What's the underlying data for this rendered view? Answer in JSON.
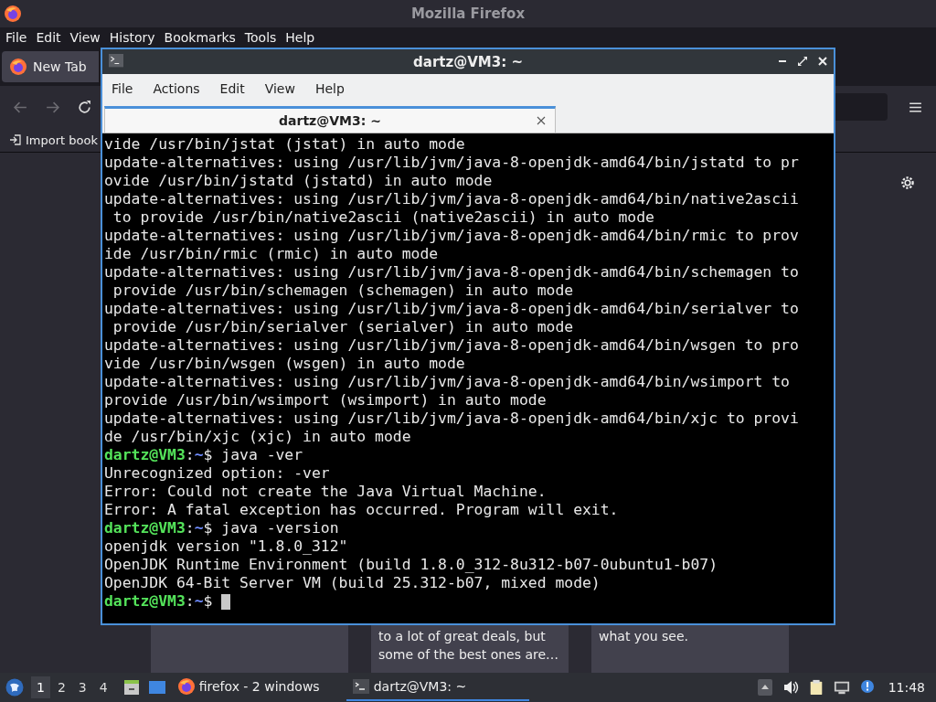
{
  "firefox": {
    "title": "Mozilla Firefox",
    "menu": [
      "File",
      "Edit",
      "View",
      "History",
      "Bookmarks",
      "Tools",
      "Help"
    ],
    "tabs": [
      {
        "label": "New Tab",
        "selected": true
      }
    ],
    "bookmarks": [
      "Import book"
    ],
    "cards": [
      {
        "kind": "blank"
      },
      {
        "kind": "text",
        "lines": [
          "to a lot of great deals, but",
          "some of the best ones are…"
        ]
      },
      {
        "kind": "text",
        "lines": [
          "what you see."
        ]
      }
    ]
  },
  "terminal": {
    "title": "dartz@VM3: ~",
    "menu": [
      "File",
      "Actions",
      "Edit",
      "View",
      "Help"
    ],
    "tabs": [
      {
        "label": "dartz@VM3: ~",
        "selected": true
      }
    ],
    "lines": [
      {
        "kind": "output",
        "text": "vide /usr/bin/jstat (jstat) in auto mode"
      },
      {
        "kind": "output",
        "text": "update-alternatives: using /usr/lib/jvm/java-8-openjdk-amd64/bin/jstatd to pr"
      },
      {
        "kind": "output",
        "text": "ovide /usr/bin/jstatd (jstatd) in auto mode"
      },
      {
        "kind": "output",
        "text": "update-alternatives: using /usr/lib/jvm/java-8-openjdk-amd64/bin/native2ascii"
      },
      {
        "kind": "output",
        "text": " to provide /usr/bin/native2ascii (native2ascii) in auto mode"
      },
      {
        "kind": "output",
        "text": "update-alternatives: using /usr/lib/jvm/java-8-openjdk-amd64/bin/rmic to prov"
      },
      {
        "kind": "output",
        "text": "ide /usr/bin/rmic (rmic) in auto mode"
      },
      {
        "kind": "output",
        "text": "update-alternatives: using /usr/lib/jvm/java-8-openjdk-amd64/bin/schemagen to"
      },
      {
        "kind": "output",
        "text": " provide /usr/bin/schemagen (schemagen) in auto mode"
      },
      {
        "kind": "output",
        "text": "update-alternatives: using /usr/lib/jvm/java-8-openjdk-amd64/bin/serialver to"
      },
      {
        "kind": "output",
        "text": " provide /usr/bin/serialver (serialver) in auto mode"
      },
      {
        "kind": "output",
        "text": "update-alternatives: using /usr/lib/jvm/java-8-openjdk-amd64/bin/wsgen to pro"
      },
      {
        "kind": "output",
        "text": "vide /usr/bin/wsgen (wsgen) in auto mode"
      },
      {
        "kind": "output",
        "text": "update-alternatives: using /usr/lib/jvm/java-8-openjdk-amd64/bin/wsimport to"
      },
      {
        "kind": "output",
        "text": "provide /usr/bin/wsimport (wsimport) in auto mode"
      },
      {
        "kind": "output",
        "text": "update-alternatives: using /usr/lib/jvm/java-8-openjdk-amd64/bin/xjc to provi"
      },
      {
        "kind": "output",
        "text": "de /usr/bin/xjc (xjc) in auto mode"
      },
      {
        "kind": "prompt",
        "parts": [
          {
            "kind": "user",
            "text": "dartz@VM3"
          },
          {
            "kind": "plain",
            "text": ":"
          },
          {
            "kind": "path",
            "text": "~"
          },
          {
            "kind": "plain",
            "text": "$ java -ver"
          }
        ]
      },
      {
        "kind": "output",
        "text": "Unrecognized option: -ver"
      },
      {
        "kind": "output",
        "text": "Error: Could not create the Java Virtual Machine."
      },
      {
        "kind": "output",
        "text": "Error: A fatal exception has occurred. Program will exit."
      },
      {
        "kind": "prompt",
        "parts": [
          {
            "kind": "user",
            "text": "dartz@VM3"
          },
          {
            "kind": "plain",
            "text": ":"
          },
          {
            "kind": "path",
            "text": "~"
          },
          {
            "kind": "plain",
            "text": "$ java -version"
          }
        ]
      },
      {
        "kind": "output",
        "text": "openjdk version \"1.8.0_312\""
      },
      {
        "kind": "output",
        "text": "OpenJDK Runtime Environment (build 1.8.0_312-8u312-b07-0ubuntu1-b07)"
      },
      {
        "kind": "output",
        "text": "OpenJDK 64-Bit Server VM (build 25.312-b07, mixed mode)"
      },
      {
        "kind": "prompt",
        "cursor": true,
        "parts": [
          {
            "kind": "user",
            "text": "dartz@VM3"
          },
          {
            "kind": "plain",
            "text": ":"
          },
          {
            "kind": "path",
            "text": "~"
          },
          {
            "kind": "plain",
            "text": "$ "
          }
        ]
      }
    ]
  },
  "taskbar": {
    "workspaces": [
      {
        "label": "1",
        "selected": true
      },
      {
        "label": "2",
        "selected": false
      },
      {
        "label": "3",
        "selected": false
      },
      {
        "label": "4",
        "selected": false
      }
    ],
    "tasks": [
      {
        "kind": "browser",
        "label": "firefox - 2 windows",
        "selected": false
      },
      {
        "kind": "terminal",
        "label": "dartz@VM3: ~",
        "selected": true
      }
    ],
    "clock": "11:48"
  }
}
